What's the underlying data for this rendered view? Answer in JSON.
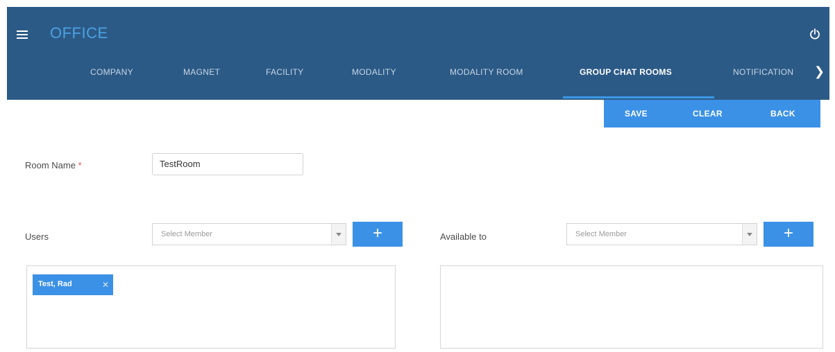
{
  "header": {
    "brand": "OFFICE",
    "tabs": [
      {
        "label": "COMPANY"
      },
      {
        "label": "MAGNET"
      },
      {
        "label": "FACILITY"
      },
      {
        "label": "MODALITY"
      },
      {
        "label": "MODALITY ROOM"
      },
      {
        "label": "GROUP CHAT ROOMS"
      },
      {
        "label": "NOTIFICATION"
      }
    ],
    "active_tab": "GROUP CHAT ROOMS",
    "next_symbol": "❯"
  },
  "actions": {
    "save": "SAVE",
    "clear": "CLEAR",
    "back": "BACK"
  },
  "form": {
    "room_name_label": "Room Name",
    "required_mark": "*",
    "room_name_value": "TestRoom",
    "users_label": "Users",
    "users_select_placeholder": "Select Member",
    "available_label": "Available to",
    "available_select_placeholder": "Select Member",
    "add_symbol": "+",
    "selected_users": [
      {
        "name": "Test, Rad",
        "remove": "✕"
      }
    ]
  },
  "colors": {
    "header_bg": "#2c5a86",
    "accent": "#3b91e6",
    "brand": "#4aa2e3"
  },
  "icons": [
    "menu-icon",
    "power-icon",
    "chevron-right-icon",
    "plus-icon",
    "dropdown-arrow-icon",
    "remove-icon"
  ]
}
